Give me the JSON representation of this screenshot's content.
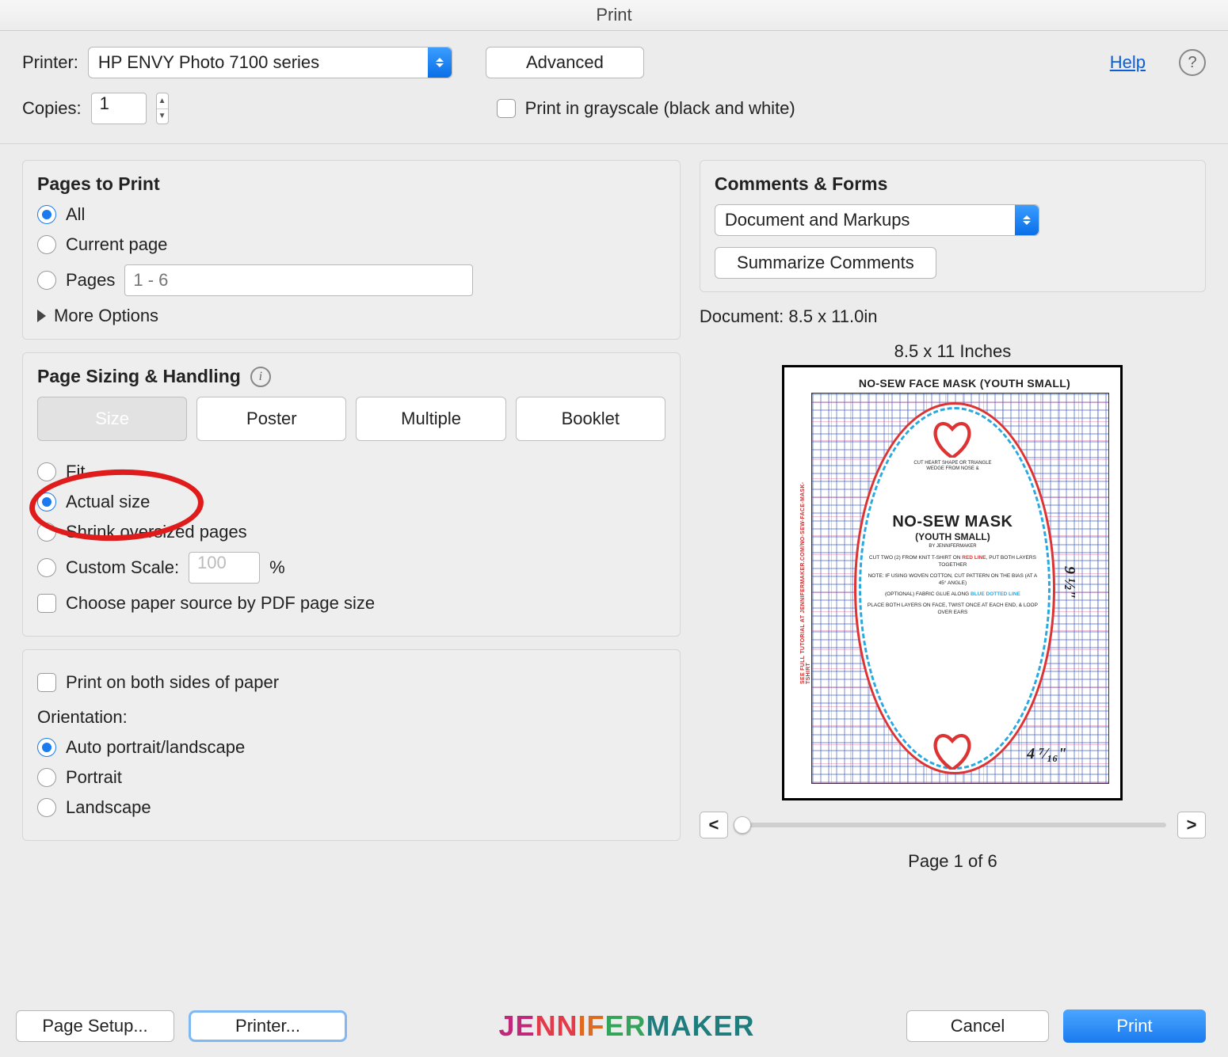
{
  "window": {
    "title": "Print"
  },
  "top": {
    "printer_label": "Printer:",
    "printer_value": "HP ENVY Photo 7100 series",
    "advanced": "Advanced",
    "help": "Help",
    "copies_label": "Copies:",
    "copies_value": "1",
    "grayscale": "Print in grayscale (black and white)"
  },
  "pages": {
    "title": "Pages to Print",
    "all": "All",
    "current": "Current page",
    "pages": "Pages",
    "pages_placeholder": "1 - 6",
    "more": "More Options"
  },
  "sizing": {
    "title": "Page Sizing & Handling",
    "tabs": {
      "size": "Size",
      "poster": "Poster",
      "multiple": "Multiple",
      "booklet": "Booklet"
    },
    "fit": "Fit",
    "actual": "Actual size",
    "shrink": "Shrink oversized pages",
    "custom": "Custom Scale:",
    "custom_value": "100",
    "custom_unit": "%",
    "source": "Choose paper source by PDF page size"
  },
  "duplex": {
    "both": "Print on both sides of paper",
    "orientation_label": "Orientation:",
    "auto": "Auto portrait/landscape",
    "portrait": "Portrait",
    "landscape": "Landscape"
  },
  "comments": {
    "title": "Comments & Forms",
    "select_value": "Document and Markups",
    "summarize": "Summarize Comments"
  },
  "preview": {
    "doc_dims": "Document: 8.5 x 11.0in",
    "page_dims": "8.5 x 11 Inches",
    "title_text": "NO-SEW FACE MASK (YOUTH SMALL)",
    "mask_h1": "NO-SEW MASK",
    "mask_h2": "(YOUTH SMALL)",
    "mask_by": "BY JENNIFERMAKER",
    "mask_l1a": "CUT TWO (2) FROM KNIT T-SHIRT ON ",
    "mask_l1b": "RED LINE",
    "mask_l1c": ", PUT BOTH LAYERS TOGETHER",
    "mask_l2": "NOTE: IF USING WOVEN COTTON, CUT PATTERN ON THE BIAS (AT A 45° ANGLE)",
    "mask_l3a": "(OPTIONAL) FABRIC GLUE ALONG ",
    "mask_l3b": "BLUE DOTTED LINE",
    "mask_l4": "PLACE BOTH LAYERS ON FACE, TWIST ONCE AT EACH END, & LOOP OVER EARS",
    "side_text": "SEE FULL TUTORIAL AT JENNIFERMAKER.COM/NO-SEW-FACE-MASK-TSHIRT",
    "heart_t": "CUT HEART SHAPE OR TRIANGLE WEDGE FROM NOSE &",
    "w_meas": "9 ½\"",
    "b_meas": "4 ⁷⁄₁₆\"",
    "prev": "<",
    "next": ">",
    "page_of": "Page 1 of 6"
  },
  "footer": {
    "page_setup": "Page Setup...",
    "printer": "Printer...",
    "cancel": "Cancel",
    "print": "Print",
    "brand1": "JENNIFER",
    "brand2": "MAKER"
  }
}
